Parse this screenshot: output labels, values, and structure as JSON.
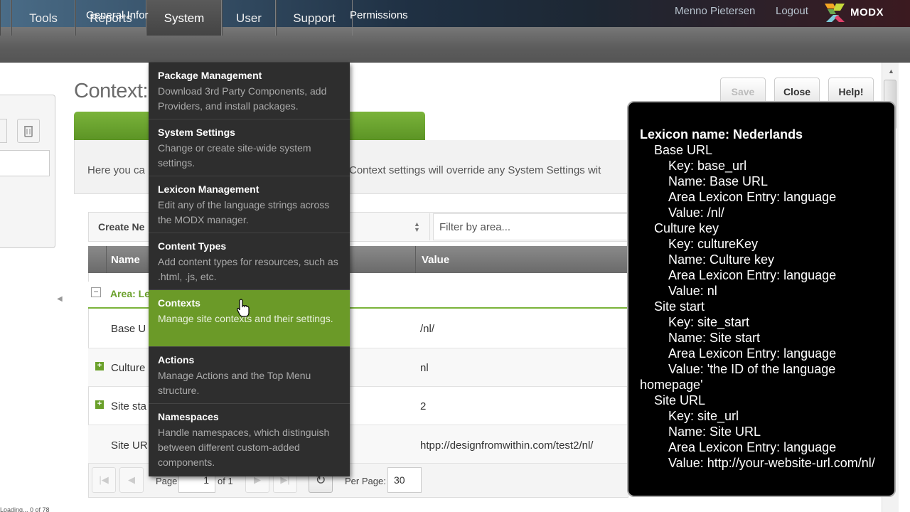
{
  "header": {
    "user_name": "Menno Pietersen",
    "logout_label": "Logout",
    "logo_text": "MODX"
  },
  "menu": {
    "items": [
      {
        "label": "Tools"
      },
      {
        "label": "Reports"
      },
      {
        "label": "System"
      },
      {
        "label": "User"
      },
      {
        "label": "Support"
      }
    ]
  },
  "dropdown": {
    "items": [
      {
        "title": "Package Management",
        "desc": "Download 3rd Party Components, add Providers, and install packages."
      },
      {
        "title": "System Settings",
        "desc": "Change or create site-wide system settings."
      },
      {
        "title": "Lexicon Management",
        "desc": "Edit any of the language strings across the MODX manager."
      },
      {
        "title": "Content Types",
        "desc": "Add content types for resources, such as .html, .js, etc."
      },
      {
        "title": "Contexts",
        "desc": "Manage site contexts and their settings."
      },
      {
        "title": "Actions",
        "desc": "Manage Actions and the Top Menu structure."
      },
      {
        "title": "Namespaces",
        "desc": "Handle namespaces, which distinguish between different custom-added components."
      }
    ]
  },
  "page": {
    "title": "Context:",
    "save_label": "Save",
    "close_label": "Close",
    "help_label": "Help!",
    "tab_general": "General Infor",
    "tab_permissions": "Permissions",
    "desc_left": "Here you ca",
    "desc_right": "Context settings will override any System Settings wit"
  },
  "grid": {
    "create_label": "Create Ne",
    "filter_placeholder": "Filter by area...",
    "col_name": "Name",
    "col_value": "Value",
    "group_label": "Area: Le",
    "rows": [
      {
        "name": "Base U",
        "value": "/nl/"
      },
      {
        "name": "Culture",
        "value": "nl"
      },
      {
        "name": "Site sta",
        "value": "2"
      },
      {
        "name": "Site UR",
        "value": "htpp://designfromwithin.com/test2/nl/"
      }
    ]
  },
  "pager": {
    "page_label": "Page",
    "page_value": "1",
    "of_label": "of 1",
    "per_page_label": "Per Page:",
    "per_page_value": "30"
  },
  "status": {
    "text": "Loading... 0 of 78"
  },
  "tooltip": {
    "title": "Lexicon name: Nederlands",
    "lines": [
      "Base URL",
      "Key: base_url",
      "Name: Base URL",
      "Area Lexicon Entry: language",
      "Value: /nl/",
      "Culture key",
      "Key: cultureKey",
      "Name: Culture key",
      "Area Lexicon Entry: language",
      "Value: nl",
      "Site start",
      "Key: site_start",
      "Name: Site start",
      "Area Lexicon Entry: language",
      "Value: 'the ID of the language",
      "homepage'",
      "Site URL",
      "Key: site_url",
      "Name: Site URL",
      "Area Lexicon Entry: language",
      "Value: http://your-website-url.com/nl/"
    ]
  },
  "colors": {
    "accent_green": "#6b9a28",
    "menu_dark": "#2e2e2e"
  }
}
